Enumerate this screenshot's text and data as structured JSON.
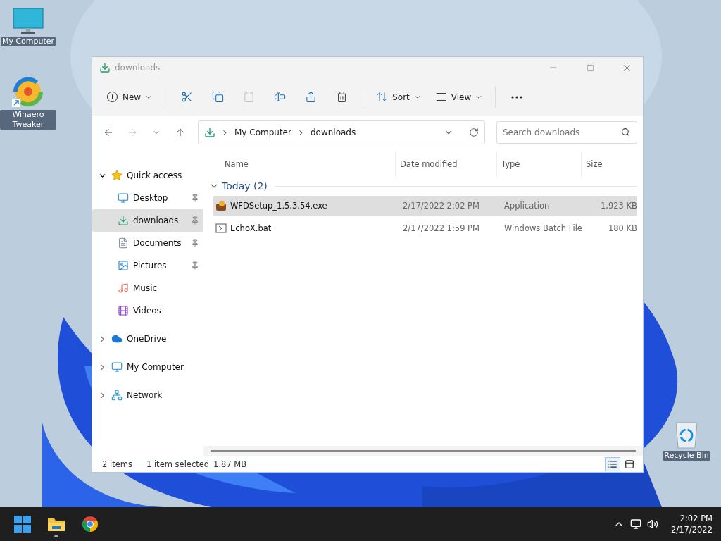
{
  "desktop_icons": [
    {
      "kind": "monitor",
      "label": "My Computer"
    },
    {
      "kind": "app",
      "label": "Winaero Tweaker"
    },
    {
      "kind": "bin",
      "label": "Recycle Bin"
    }
  ],
  "window": {
    "title": "downloads"
  },
  "toolbar": {
    "new": "New",
    "sort": "Sort",
    "view": "View",
    "actions": [
      {
        "kind": "cut",
        "disabled": false
      },
      {
        "kind": "copy",
        "disabled": false
      },
      {
        "kind": "paste",
        "disabled": true
      },
      {
        "kind": "rename",
        "disabled": false
      },
      {
        "kind": "share",
        "disabled": false
      },
      {
        "kind": "delete",
        "disabled": false
      }
    ]
  },
  "nav": [
    {
      "kind": "back",
      "disabled": false
    },
    {
      "kind": "forward",
      "disabled": true
    },
    {
      "kind": "recent",
      "disabled": false
    },
    {
      "kind": "up",
      "disabled": false
    }
  ],
  "address": {
    "path": [
      "My Computer",
      "downloads"
    ]
  },
  "search": {
    "placeholder": "Search downloads"
  },
  "sidebar": {
    "items": [
      {
        "kind": "star",
        "label": "Quick access",
        "expanded": true,
        "selected": false,
        "children": [
          {
            "kind": "desktop",
            "label": "Desktop",
            "selected": false,
            "pinned": true
          },
          {
            "kind": "download",
            "label": "downloads",
            "selected": true,
            "pinned": true
          },
          {
            "kind": "documents",
            "label": "Documents",
            "selected": false,
            "pinned": true
          },
          {
            "kind": "pictures",
            "label": "Pictures",
            "selected": false,
            "pinned": true
          },
          {
            "kind": "music",
            "label": "Music",
            "selected": false,
            "pinned": false
          },
          {
            "kind": "videos",
            "label": "Videos",
            "selected": false,
            "pinned": false
          }
        ]
      },
      {
        "kind": "cloud",
        "label": "OneDrive",
        "expanded": false,
        "selected": false
      },
      {
        "kind": "monitor",
        "label": "My Computer",
        "expanded": false,
        "selected": false
      },
      {
        "kind": "network",
        "label": "Network",
        "expanded": false,
        "selected": false
      }
    ]
  },
  "table": {
    "columns": [
      "Name",
      "Date modified",
      "Type",
      "Size"
    ],
    "group": {
      "label": "Today (2)",
      "expanded": true
    },
    "rows": [
      {
        "kind": "exe",
        "name": "WFDSetup_1.5.3.54.exe",
        "date": "2/17/2022 2:02 PM",
        "type": "Application",
        "size": "1,923 KB",
        "selected": true
      },
      {
        "kind": "bat",
        "name": "EchoX.bat",
        "date": "2/17/2022 1:59 PM",
        "type": "Windows Batch File",
        "size": "180 KB",
        "selected": false
      }
    ]
  },
  "status_bar": {
    "items": "2 items",
    "selection": "1 item selected",
    "size": "1.87 MB",
    "views": [
      {
        "kind": "details",
        "selected": true
      },
      {
        "kind": "tiles",
        "selected": false
      }
    ]
  },
  "taskbar": {
    "apps": [
      {
        "kind": "start",
        "running": false
      },
      {
        "kind": "explorer",
        "running": true
      },
      {
        "kind": "chrome",
        "running": false
      }
    ],
    "time": "2:02 PM",
    "date": "2/17/2022"
  }
}
